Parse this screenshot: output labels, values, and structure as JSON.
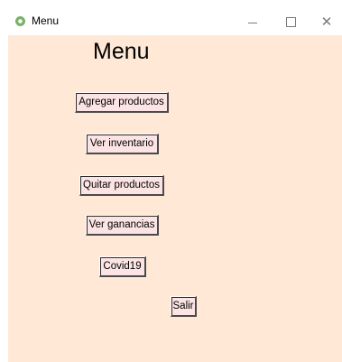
{
  "window": {
    "title": "Menu",
    "controls": {
      "minimize": "minimize-icon",
      "maximize": "maximize-icon",
      "close": "close-icon"
    }
  },
  "main": {
    "heading": "Menu",
    "buttons": [
      {
        "label": "Agregar productos"
      },
      {
        "label": "Ver inventario"
      },
      {
        "label": "Quitar productos"
      },
      {
        "label": "Ver ganancias"
      },
      {
        "label": "Covid19"
      },
      {
        "label": "Salir"
      }
    ]
  },
  "colors": {
    "background": "#ffe9d6",
    "button": "#fde4e4"
  }
}
